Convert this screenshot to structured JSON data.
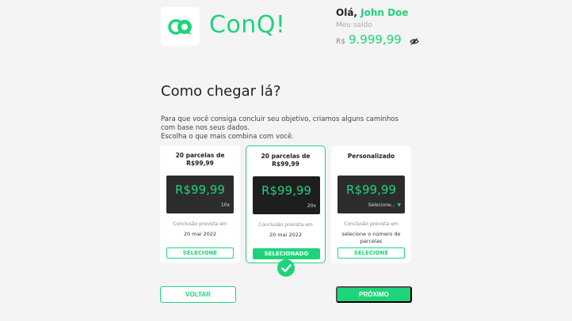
{
  "header": {
    "brand": "ConQ!",
    "greeting_prefix": "Olá,",
    "user_name": "John Doe",
    "balance_label": "Meu saldo",
    "currency": "R$",
    "balance": "9.999,99"
  },
  "main": {
    "title": "Como chegar lá?",
    "description_1": "Para que você consiga concluir seu objetivo, criamos alguns caminhos com base nos seus dados.",
    "description_2": "Escolha o que mais combina com você.",
    "cards": [
      {
        "title": "20 parcelas de R$99,99",
        "price": "R$99,99",
        "sub": "10x",
        "conclusion_label": "Conclusão prevista em",
        "conclusion_value": "20 mai 2022",
        "button": "SELECIONE"
      },
      {
        "title": "20 parcelas de R$99,99",
        "price": "R$99,99",
        "sub": "20x",
        "conclusion_label": "Conclusão prevista em",
        "conclusion_value": "20 mai 2022",
        "button": "SELECIONADO"
      },
      {
        "title": "Personalizado",
        "price": "R$99,99",
        "sub": "Selecione...",
        "conclusion_label": "Conclusão prevista em",
        "conclusion_value": "selecione o número de parcelas",
        "button": "SELECIONE"
      }
    ]
  },
  "footer": {
    "back": "VOLTAR",
    "next": "PRÓXIMO"
  },
  "colors": {
    "accent": "#1ed47a",
    "dark": "#2c2c2c",
    "background": "#f4f4f4"
  },
  "icons": [
    "logo-icon",
    "eye-off-icon",
    "check-circle-icon",
    "caret-down-icon"
  ]
}
